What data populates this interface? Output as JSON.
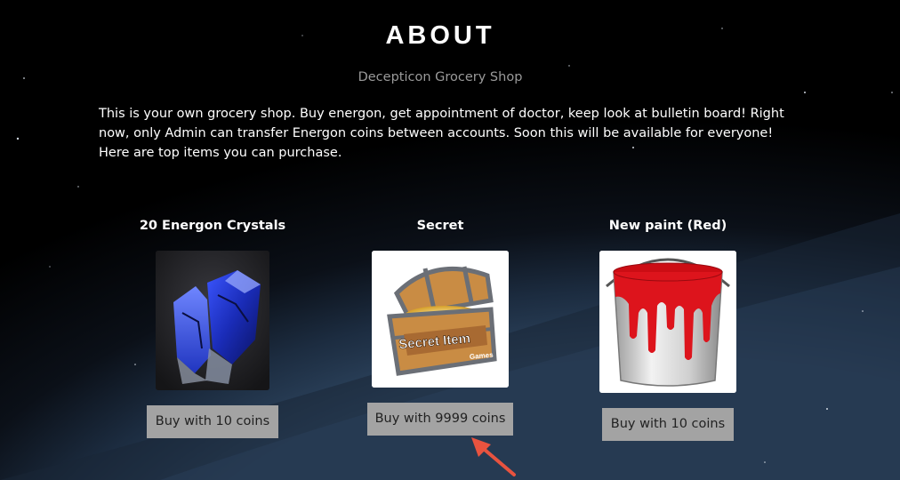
{
  "header": {
    "title": "ABOUT",
    "subtitle": "Decepticon Grocery Shop"
  },
  "intro": "This is your own grocery shop. Buy energon, get appointment of doctor, keep look at bulletin board! Right now, only Admin can transfer Energon coins between accounts. Soon this will be available for everyone! Here are top items you can purchase.",
  "products": [
    {
      "name": "20 Energon Crystals",
      "image": "blue-crystal",
      "button_label": "Buy with 10 coins"
    },
    {
      "name": "Secret",
      "image": "treasure-chest",
      "image_text_main": "Secret Item",
      "image_text_sub": "Games",
      "button_label": "Buy with 9999 coins"
    },
    {
      "name": "New paint (Red)",
      "image": "red-paint-bucket",
      "button_label": "Buy with 10 coins"
    }
  ],
  "annotation": {
    "arrow_color": "#e8533f"
  }
}
